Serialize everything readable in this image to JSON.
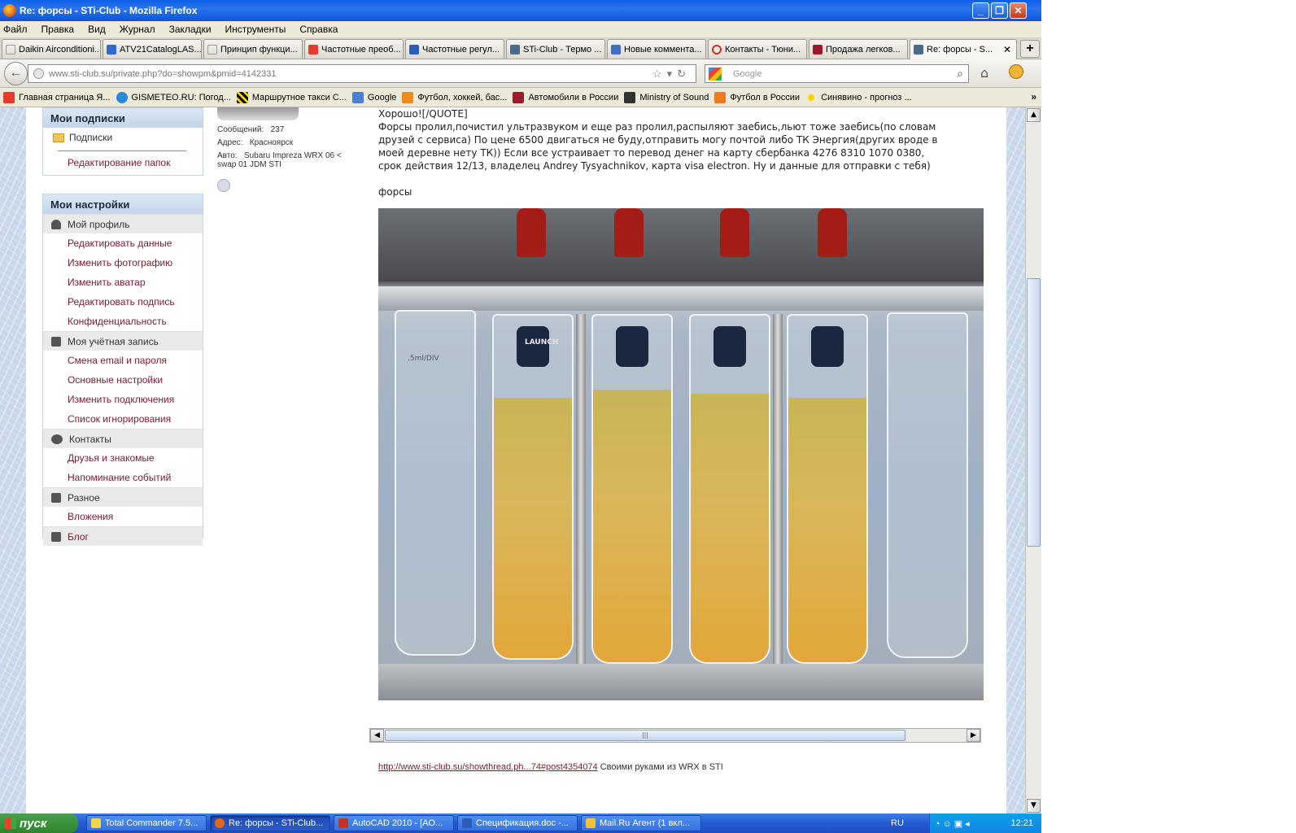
{
  "window": {
    "title": "Re: форсы - STi-Club - Mozilla Firefox"
  },
  "menu": [
    "Файл",
    "Правка",
    "Вид",
    "Журнал",
    "Закладки",
    "Инструменты",
    "Справка"
  ],
  "tabs": [
    "Daikin Airconditioni...",
    "ATV21CatalogLAS...",
    "Принцип функци...",
    "Частотные преоб...",
    "Частотные регул...",
    "STi-Club - Термо ...",
    "Новые коммента...",
    "Контакты - Тюни...",
    "Продажа легков...",
    "Re: форсы - S..."
  ],
  "nav": {
    "url_host": "www.sti-club.su",
    "url_path": "/private.php?do=showpm&pmid=4142331",
    "search_placeholder": "Google"
  },
  "bookmarks": [
    "Главная страница Я...",
    "GISMETEO.RU: Погод...",
    "Маршрутное такси С...",
    "Google",
    "Футбол, хоккей, бас...",
    "Автомобили в России",
    "Ministry of Sound",
    "Футбол в России",
    "Синявино - прогноз ..."
  ],
  "sidebar": {
    "subs_title": "Мои подписки",
    "subs_folder": "Подписки",
    "subs_edit": "Редактирование папок",
    "settings_title": "Мои настройки",
    "profile_group": "Мой профиль",
    "profile_links": [
      "Редактировать данные",
      "Изменить фотографию",
      "Изменить аватар",
      "Редактировать подпись",
      "Конфиденциальность"
    ],
    "account_group": "Моя учётная запись",
    "account_links": [
      "Смена email и пароля",
      "Основные настройки",
      "Изменить подключения",
      "Список игнорирования"
    ],
    "contacts_group": "Контакты",
    "contacts_links": [
      "Друзья и знакомые",
      "Напоминание событий"
    ],
    "misc_group": "Разное",
    "misc_links": [
      "Вложения"
    ],
    "blog": "Блог"
  },
  "user": {
    "posts_label": "Сообщений:",
    "posts": "237",
    "addr_label": "Адрес:",
    "addr": "Красноярск",
    "car_label": "Авто:",
    "car": "Subaru Impreza WRX 06 < swap 01 JDM STI"
  },
  "message": {
    "quote_end": "Хорошо![/QUOTE]",
    "body": "Форсы пролил,почистил ультразвуком и еще раз пролил,распыляют заебись,льют тоже заебись(по словам друзей с сервиса) По цене 6500 двигаться не буду,отправить могу почтой либо ТК Энергия(других вроде в моей деревне нету ТК)) Если все устраивает то перевод денег на карту сбербанка 4276 8310 1070 0380, срок действия 12/13, владелец Andrey Tysyachnikov, карта visa electron. Ну и данные для отправки с тебя)",
    "caption": "форсы",
    "photo_labels": {
      "div": ".5ml/DIV",
      "brand": "LAUNCH"
    }
  },
  "signature": {
    "link": "http://www.sti-club.su/showthread.ph...74#post4354074",
    "text": " Своими руками из WRX в STI"
  },
  "taskbar": {
    "start": "пуск",
    "tasks": [
      "Total Commander 7.5...",
      "Re: форсы - STi-Club...",
      "AutoCAD 2010 - [AO...",
      "Спецификация.doc -...",
      "Mail.Ru Агент (1 вкл..."
    ],
    "lang": "RU",
    "clock": "12:21"
  }
}
